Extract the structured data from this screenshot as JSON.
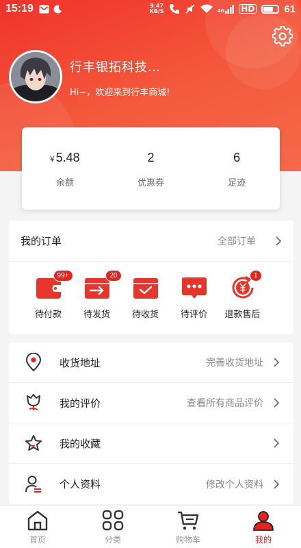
{
  "status_bar": {
    "time": "15:19",
    "net_speed_value": "9.47",
    "net_speed_unit": "KB/S",
    "signal_label": "4G",
    "hd_label": "HD",
    "battery": "61"
  },
  "profile": {
    "name": "行丰银拓科技…",
    "welcome": "Hi~，欢迎来到行丰商城!"
  },
  "stats": [
    {
      "currency": "¥",
      "value": "5.48",
      "label": "余额"
    },
    {
      "currency": "",
      "value": "2",
      "label": "优惠券"
    },
    {
      "currency": "",
      "value": "6",
      "label": "足迹"
    }
  ],
  "orders": {
    "title": "我的订单",
    "all_label": "全部订单",
    "items": [
      {
        "label": "待付款",
        "badge": "99+",
        "icon": "wallet-icon"
      },
      {
        "label": "待发货",
        "badge": "20",
        "icon": "ship-box-icon"
      },
      {
        "label": "待收货",
        "badge": "",
        "icon": "receive-box-icon"
      },
      {
        "label": "待评价",
        "badge": "",
        "icon": "comment-icon"
      },
      {
        "label": "退款售后",
        "badge": "1",
        "icon": "refund-icon"
      }
    ]
  },
  "menu": [
    {
      "label": "收货地址",
      "hint": "完善收货地址",
      "icon": "location-pin-icon"
    },
    {
      "label": "我的评价",
      "hint": "查看所有商品评价",
      "icon": "review-flower-icon"
    },
    {
      "label": "我的收藏",
      "hint": "",
      "icon": "star-icon"
    },
    {
      "label": "个人资料",
      "hint": "修改个人资料",
      "icon": "profile-icon"
    }
  ],
  "tabs": [
    {
      "label": "首页",
      "icon": "home-icon",
      "active": false
    },
    {
      "label": "分类",
      "icon": "category-grid-icon",
      "active": false
    },
    {
      "label": "购物车",
      "icon": "cart-icon",
      "active": false
    },
    {
      "label": "我的",
      "icon": "user-icon",
      "active": true
    }
  ],
  "colors": {
    "brand_red": "#e8231f",
    "header_gradient_start": "#f0322a",
    "header_gradient_end": "#f7684a"
  }
}
